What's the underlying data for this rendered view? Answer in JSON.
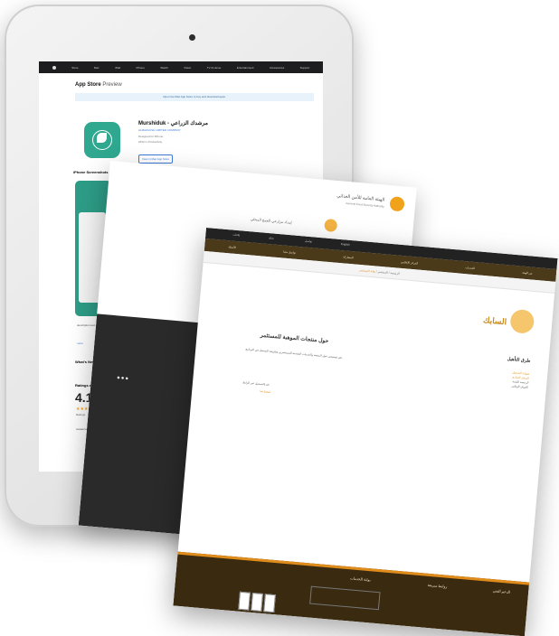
{
  "ipad": {
    "nav": [
      "Apple",
      "Store",
      "Mac",
      "iPad",
      "iPhone",
      "Watch",
      "Vision",
      "AirPods",
      "TV & Home",
      "Entertainment",
      "Accessories",
      "Support"
    ],
    "store_title": "App Store",
    "store_sub": "Preview",
    "banner": "Open the Mac App Store to buy and download apps.",
    "app_name": "Murshiduk - مرشدك الزراعي",
    "developer": "ALMAZAUSH LIMITED COMPANY",
    "designed_for": "Designed for iPhone",
    "category": "#152 in Productivity",
    "price": "Free",
    "view_button": "View in Mac App Store",
    "screenshots_heading": "iPhone Screenshots",
    "description": "description text",
    "more_label": "more",
    "whats_new": "What's New",
    "ratings_heading": "Ratings and Reviews",
    "rating_value": "4.1",
    "rating_of": "out of 5",
    "stars": "★★★★★",
    "ratings_count": "Ratings",
    "review_snippet": "review text"
  },
  "doc1": {
    "org": "الهيئة العامة للأمن الغذائي",
    "org_en": "General Food Security Authority",
    "caption": "إمداد مزارعي القمح المحلي",
    "dots": "●●●"
  },
  "doc2": {
    "top_links": [
      "بلاغات",
      "نجاح",
      "تواصل",
      "English"
    ],
    "nav": [
      "عن الهيئة",
      "الخدمات",
      "المركز الإعلامي",
      "المشاركة",
      "تواصل معنا",
      "الأسئلة"
    ],
    "crumbs_1": "الرئيسية",
    "crumbs_2": "المستثمر",
    "crumbs_3": "بوابة المستثمر",
    "brand": "السابك",
    "title": "حول منتجات الموهبة للمستثمر",
    "body": "نص توضيحي حول المنصة والخدمات المقدمة للمستثمرين وطريقة التسجيل في البرنامج.",
    "line": "قم بالتسجيل عبر الرابط",
    "link": "اضغط هنا",
    "side_title": "طرق التأهيل",
    "side_items": [
      "شهادة التسجيل",
      "السجل التجاري",
      "الرخصة البلدية",
      "العنوان الوطني"
    ],
    "footer_cols": [
      "روابط سريعة",
      "بوابة الخدمات",
      "الدعم الفني"
    ]
  }
}
